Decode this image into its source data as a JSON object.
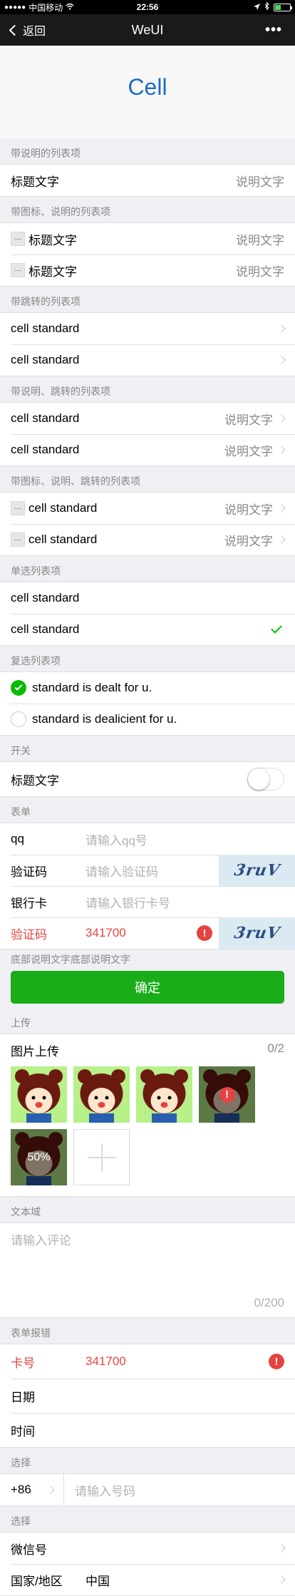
{
  "status": {
    "carrier": "中国移动",
    "time": "22:56"
  },
  "nav": {
    "back": "返回",
    "title": "WeUI",
    "more": "•••"
  },
  "page_title": "Cell",
  "s1": {
    "title": "带说明的列表项",
    "cell": {
      "label": "标题文字",
      "desc": "说明文字"
    }
  },
  "s2": {
    "title": "带图标、说明的列表项",
    "cells": [
      {
        "label": "标题文字",
        "desc": "说明文字"
      },
      {
        "label": "标题文字",
        "desc": "说明文字"
      }
    ]
  },
  "s3": {
    "title": "带跳转的列表项",
    "cells": [
      {
        "label": "cell standard"
      },
      {
        "label": "cell standard"
      }
    ]
  },
  "s4": {
    "title": "带说明、跳转的列表项",
    "cells": [
      {
        "label": "cell standard",
        "desc": "说明文字"
      },
      {
        "label": "cell standard",
        "desc": "说明文字"
      }
    ]
  },
  "s5": {
    "title": "带图标、说明、跳转的列表项",
    "cells": [
      {
        "label": "cell standard",
        "desc": "说明文字"
      },
      {
        "label": "cell standard",
        "desc": "说明文字"
      }
    ]
  },
  "s6": {
    "title": "单选列表项",
    "cells": [
      {
        "label": "cell standard"
      },
      {
        "label": "cell standard"
      }
    ]
  },
  "s7": {
    "title": "复选列表项",
    "cells": [
      {
        "label": "standard is dealt for u."
      },
      {
        "label": "standard is dealicient for u."
      }
    ]
  },
  "s8": {
    "title": "开关",
    "cell": {
      "label": "标题文字"
    }
  },
  "form": {
    "title": "表单",
    "qq": {
      "label": "qq",
      "placeholder": "请输入qq号"
    },
    "code": {
      "label": "验证码",
      "placeholder": "请输入验证码",
      "vcode": "3ruV"
    },
    "bank": {
      "label": "银行卡",
      "placeholder": "请输入银行卡号"
    },
    "code_err": {
      "label": "验证码",
      "value": "341700",
      "vcode": "3ruV"
    },
    "tips": "底部说明文字底部说明文字",
    "submit": "确定"
  },
  "upload": {
    "title": "上传",
    "label": "图片上传",
    "count": "0/2",
    "progress": "50%"
  },
  "textarea": {
    "title": "文本域",
    "placeholder": "请输入评论",
    "counter": "0/200"
  },
  "form_err": {
    "title": "表单报错",
    "card": {
      "label": "卡号",
      "value": "341700"
    },
    "date": "日期",
    "time": "时间"
  },
  "select1": {
    "title": "选择",
    "code": "+86",
    "placeholder": "请输入号码"
  },
  "select2": {
    "title": "选择",
    "wechat": "微信号",
    "country_label": "国家/地区",
    "country_value": "中国"
  }
}
